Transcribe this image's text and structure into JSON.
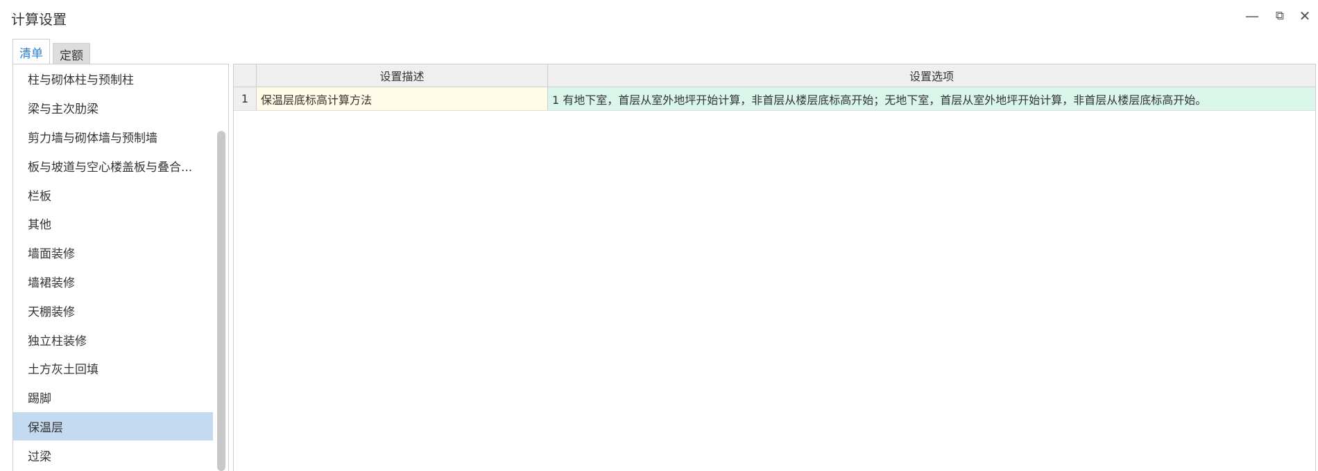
{
  "window": {
    "title": "计算设置",
    "minimize_icon": "minimize-icon",
    "restore_icon": "restore-icon",
    "close_icon": "close-icon"
  },
  "tabs": [
    {
      "label": "清单",
      "active": true
    },
    {
      "label": "定额",
      "active": false
    }
  ],
  "sidebar": {
    "items": [
      "柱与砌体柱与预制柱",
      "梁与主次肋梁",
      "剪力墙与砌体墙与预制墙",
      "板与坡道与空心楼盖板与叠合...",
      "栏板",
      "其他",
      "墙面装修",
      "墙裙装修",
      "天棚装修",
      "独立柱装修",
      "土方灰土回填",
      "踢脚",
      "保温层",
      "过梁"
    ],
    "selected": "保温层"
  },
  "grid": {
    "headers": [
      "",
      "设置描述",
      "设置选项"
    ],
    "rows": [
      {
        "num": "1",
        "desc": "保温层底标高计算方法",
        "option": "1 有地下室，首层从室外地坪开始计算，非首层从楼层底标高开始；无地下室，首层从室外地坪开始计算，非首层从楼层底标高开始。"
      }
    ]
  },
  "colors": {
    "accent": "#2a7fd6",
    "selected": "#c4daf0",
    "desc_cell": "#fffbe6",
    "option_cell": "#daf5ea"
  }
}
